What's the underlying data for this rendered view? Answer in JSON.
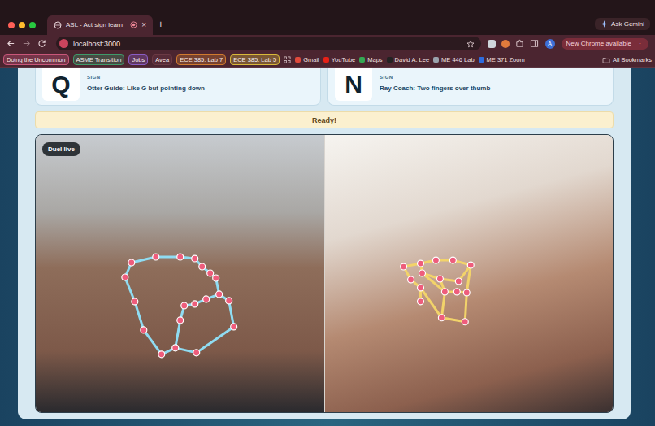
{
  "browser": {
    "tabs": [
      {
        "label": "ASL - Act sign learn",
        "selected": true,
        "close": "×"
      }
    ],
    "new_tab": "+",
    "ask_gemini": "Ask Gemini",
    "address": "localhost:3000",
    "profile": "A",
    "update": "New Chrome available",
    "menu": "⋮",
    "bookmarks": [
      {
        "label": "Doing the Uncommon",
        "kind": "group",
        "color": "#c9577a"
      },
      {
        "label": "ASME Transition",
        "kind": "group",
        "color": "#3f9a6a"
      },
      {
        "label": "Jobs",
        "kind": "group",
        "color": "#8a5cc4"
      },
      {
        "label": "Avea",
        "kind": "group",
        "color": "#6b3a44"
      },
      {
        "label": "ECE 385: Lab 7",
        "kind": "group",
        "color": "#d07a2e"
      },
      {
        "label": "ECE 385: Lab 5",
        "kind": "group",
        "color": "#d9b93a"
      },
      {
        "label": "Gmail",
        "kind": "link",
        "color": "#e04a3c"
      },
      {
        "label": "YouTube",
        "kind": "link",
        "color": "#e62117"
      },
      {
        "label": "Maps",
        "kind": "link",
        "color": "#34a853"
      },
      {
        "label": "David A. Lee",
        "kind": "link",
        "color": "#222222"
      },
      {
        "label": "ME 446 Lab",
        "kind": "link",
        "color": "#9aa3ad"
      },
      {
        "label": "ME 371 Zoom",
        "kind": "link",
        "color": "#2d6cdf"
      }
    ],
    "all_bookmarks": "All Bookmarks"
  },
  "cards": [
    {
      "letter": "Q",
      "tag": "SIGN",
      "hint": "Otter Guide: Like G but pointing down"
    },
    {
      "letter": "N",
      "tag": "SIGN",
      "hint": "Ray Coach: Two fingers over thumb"
    }
  ],
  "status": "Ready!",
  "video": {
    "badge": "Duel live"
  }
}
